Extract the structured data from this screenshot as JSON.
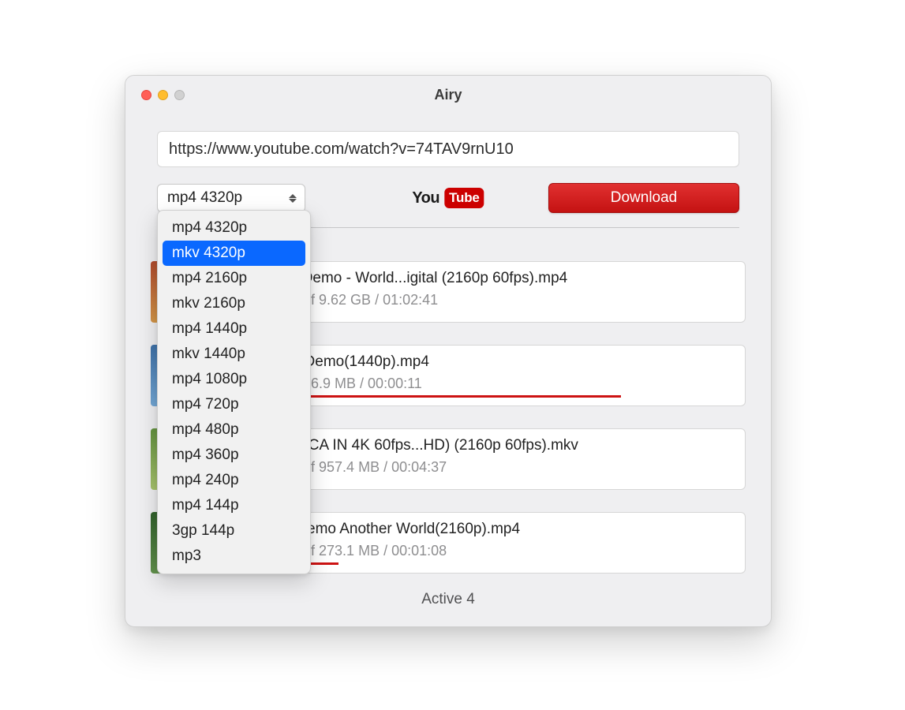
{
  "window": {
    "title": "Airy"
  },
  "url": {
    "value": "https://www.youtube.com/watch?v=74TAV9rnU10"
  },
  "format_select": {
    "value": "mp4 4320p",
    "options": [
      "mp4 4320p",
      "mkv 4320p",
      "mp4 2160p",
      "mkv 2160p",
      "mp4 1440p",
      "mkv 1440p",
      "mp4 1080p",
      "mp4 720p",
      "mp4 480p",
      "mp4 360p",
      "mp4 240p",
      "mp4 144p",
      "3gp 144p",
      "mp3"
    ],
    "highlighted": "mkv 4320p"
  },
  "logo": {
    "you": "You",
    "tube": "Tube"
  },
  "download_button": "Download",
  "items": [
    {
      "name": "rp 4K Demo - World...igital (2160p 60fps).mp4",
      "status": ".5 MB of 9.62 GB / 01:02:41",
      "progress_pct": 0
    },
    {
      "name": "Video Demo(1440p).mp4",
      "status": " MB of 76.9 MB / 00:00:11",
      "progress_pct": 75
    },
    {
      "name": "STA RICA IN 4K 60fps...HD) (2160p 60fps).mkv",
      "status": ".1 MB of 957.4 MB / 00:04:37",
      "progress_pct": 0
    },
    {
      "name": "y 4K Demo  Another World(2160p).mp4",
      "status": ".4 MB of 273.1 MB / 00:01:08",
      "progress_pct": 18
    }
  ],
  "footer": {
    "active_label": "Active 4"
  }
}
